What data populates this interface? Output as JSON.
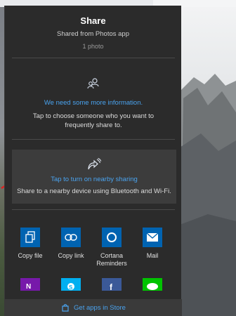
{
  "share": {
    "title": "Share",
    "subtitle": "Shared from Photos app",
    "count": "1 photo"
  },
  "people": {
    "icon": "people-search-icon",
    "heading": "We need some more information.",
    "description": "Tap to choose someone who you want to frequently share to."
  },
  "nearby": {
    "icon": "nearby-share-icon",
    "heading": "Tap to turn on nearby sharing",
    "description": "Share to a nearby device using Bluetooth and Wi-Fi."
  },
  "apps": [
    {
      "label": "Copy file",
      "icon": "copy-file-icon",
      "color": "#0063b1"
    },
    {
      "label": "Copy link",
      "icon": "copy-link-icon",
      "color": "#0063b1"
    },
    {
      "label": "Cortana Reminders",
      "icon": "cortana-icon",
      "color": "#0063b1"
    },
    {
      "label": "Mail",
      "icon": "mail-icon",
      "color": "#0063b1"
    }
  ],
  "partial_apps": [
    {
      "icon": "onenote-icon",
      "color": "#7719aa"
    },
    {
      "icon": "skype-icon",
      "color": "#00aff0"
    },
    {
      "icon": "facebook-icon",
      "color": "#3b5998"
    },
    {
      "icon": "line-icon",
      "color": "#00c300"
    }
  ],
  "store": {
    "label": "Get apps in Store",
    "icon": "store-icon"
  },
  "colors": {
    "panel": "#2b2b2b",
    "accent": "#4aa3ef",
    "tile": "#0063b1"
  }
}
